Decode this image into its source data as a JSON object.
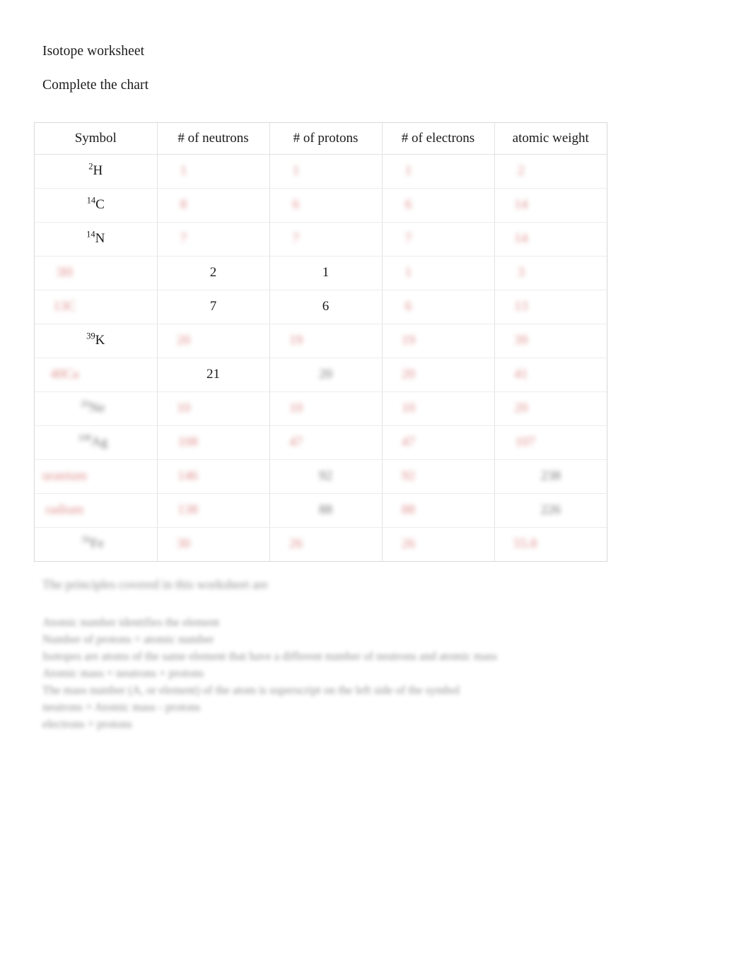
{
  "document": {
    "title": "Isotope worksheet",
    "subtitle": "Complete the chart"
  },
  "chart_data": {
    "type": "table",
    "title": "Isotope worksheet",
    "columns": [
      "Symbol",
      "# of neutrons",
      "# of protons",
      "# of electrons",
      "atomic weight"
    ],
    "rows": [
      {
        "symbol": {
          "text": "H",
          "sup": "2",
          "state": "given"
        },
        "neutrons": {
          "text": "1",
          "state": "redacted-red"
        },
        "protons": {
          "text": "1",
          "state": "redacted-red"
        },
        "electrons": {
          "text": "1",
          "state": "redacted-red"
        },
        "weight": {
          "text": "2",
          "state": "redacted-red"
        }
      },
      {
        "symbol": {
          "text": "C",
          "sup": "14",
          "state": "given"
        },
        "neutrons": {
          "text": "8",
          "state": "redacted-red"
        },
        "protons": {
          "text": "6",
          "state": "redacted-red"
        },
        "electrons": {
          "text": "6",
          "state": "redacted-red"
        },
        "weight": {
          "text": "14",
          "state": "redacted-red"
        }
      },
      {
        "symbol": {
          "text": "N",
          "sup": "14",
          "state": "given"
        },
        "neutrons": {
          "text": "7",
          "state": "redacted-red"
        },
        "protons": {
          "text": "7",
          "state": "redacted-red"
        },
        "electrons": {
          "text": "7",
          "state": "redacted-red"
        },
        "weight": {
          "text": "14",
          "state": "redacted-red"
        }
      },
      {
        "symbol": {
          "text": "3H",
          "state": "redacted-red"
        },
        "neutrons": {
          "text": "2",
          "state": "given"
        },
        "protons": {
          "text": "1",
          "state": "given"
        },
        "electrons": {
          "text": "1",
          "state": "redacted-red"
        },
        "weight": {
          "text": "3",
          "state": "redacted-red"
        }
      },
      {
        "symbol": {
          "text": "13C",
          "state": "redacted-red"
        },
        "neutrons": {
          "text": "7",
          "state": "given"
        },
        "protons": {
          "text": "6",
          "state": "given"
        },
        "electrons": {
          "text": "6",
          "state": "redacted-red"
        },
        "weight": {
          "text": "13",
          "state": "redacted-red"
        }
      },
      {
        "symbol": {
          "text": "K",
          "sup": "39",
          "state": "given"
        },
        "neutrons": {
          "text": "20",
          "state": "redacted-red"
        },
        "protons": {
          "text": "19",
          "state": "redacted-red"
        },
        "electrons": {
          "text": "19",
          "state": "redacted-red"
        },
        "weight": {
          "text": "39",
          "state": "redacted-red"
        }
      },
      {
        "symbol": {
          "text": "40Ca",
          "state": "redacted-red"
        },
        "neutrons": {
          "text": "21",
          "state": "given"
        },
        "protons": {
          "text": "20",
          "state": "redacted-dark"
        },
        "electrons": {
          "text": "20",
          "state": "redacted-red"
        },
        "weight": {
          "text": "41",
          "state": "redacted-red"
        }
      },
      {
        "symbol": {
          "text": "Ne",
          "sup": "20",
          "state": "redacted-dark"
        },
        "neutrons": {
          "text": "10",
          "state": "redacted-red"
        },
        "protons": {
          "text": "10",
          "state": "redacted-red"
        },
        "electrons": {
          "text": "10",
          "state": "redacted-red"
        },
        "weight": {
          "text": "20",
          "state": "redacted-red"
        }
      },
      {
        "symbol": {
          "text": "Ag",
          "sup": "108",
          "state": "redacted-dark"
        },
        "neutrons": {
          "text": "108",
          "state": "redacted-red"
        },
        "protons": {
          "text": "47",
          "state": "redacted-red"
        },
        "electrons": {
          "text": "47",
          "state": "redacted-red"
        },
        "weight": {
          "text": "107",
          "state": "redacted-red"
        }
      },
      {
        "symbol": {
          "text": "uranium",
          "state": "redacted-red"
        },
        "neutrons": {
          "text": "146",
          "state": "redacted-red"
        },
        "protons": {
          "text": "92",
          "state": "redacted-dark"
        },
        "electrons": {
          "text": "92",
          "state": "redacted-red"
        },
        "weight": {
          "text": "238",
          "state": "redacted-dark"
        }
      },
      {
        "symbol": {
          "text": "radium",
          "state": "redacted-red"
        },
        "neutrons": {
          "text": "138",
          "state": "redacted-red"
        },
        "protons": {
          "text": "88",
          "state": "redacted-dark"
        },
        "electrons": {
          "text": "88",
          "state": "redacted-red"
        },
        "weight": {
          "text": "226",
          "state": "redacted-dark"
        }
      },
      {
        "symbol": {
          "text": "Fe",
          "sup": "56",
          "state": "redacted-dark"
        },
        "neutrons": {
          "text": "30",
          "state": "redacted-red"
        },
        "protons": {
          "text": "26",
          "state": "redacted-red"
        },
        "electrons": {
          "text": "26",
          "state": "redacted-red"
        },
        "weight": {
          "text": "55.8",
          "state": "redacted-red"
        }
      }
    ]
  },
  "notes": {
    "title": "The principles covered in this worksheet are",
    "lines": [
      "Atomic number identifies the element",
      "Number of protons = atomic number",
      "Isotopes are atoms of the same element that have a different number of neutrons and atomic mass",
      "Atomic mass = neutrons + protons",
      "The mass number (A, or element) of the atom is superscript on the left side of the symbol",
      "neutrons = Atomic mass - protons",
      "electrons = protons"
    ]
  }
}
